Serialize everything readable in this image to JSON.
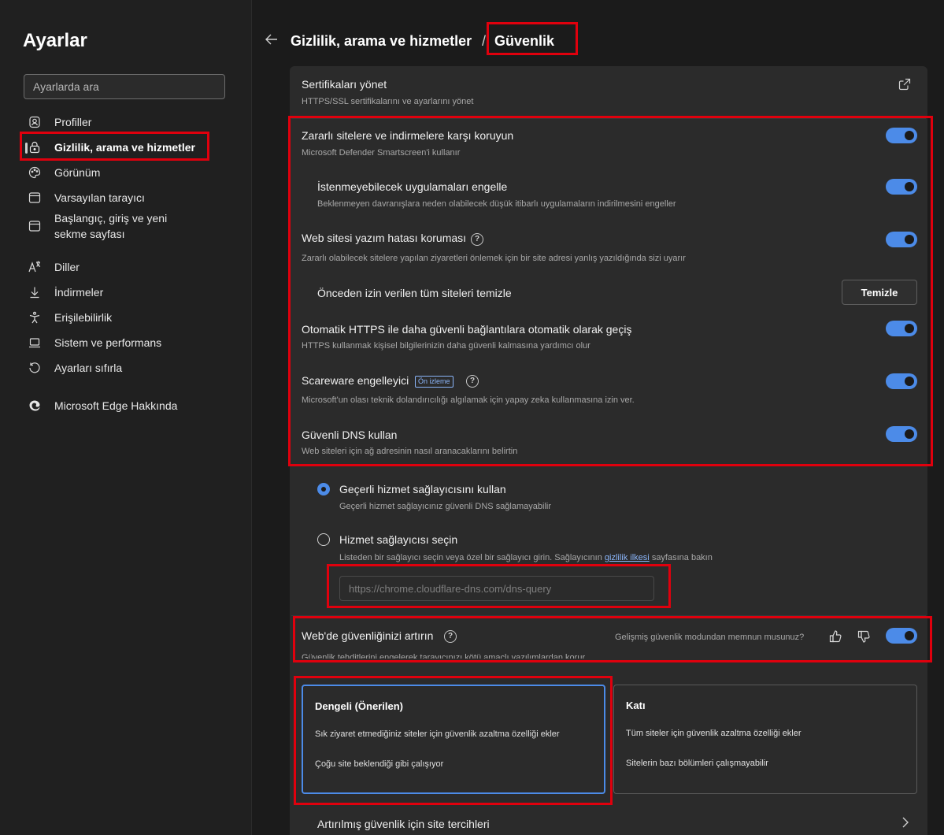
{
  "sidebar": {
    "title": "Ayarlar",
    "search_placeholder": "Ayarlarda ara",
    "items": [
      {
        "label": "Profiller",
        "icon": "profile-icon"
      },
      {
        "label": "Gizlilik, arama ve hizmetler",
        "icon": "lock-icon"
      },
      {
        "label": "Görünüm",
        "icon": "palette-icon"
      },
      {
        "label": "Varsayılan tarayıcı",
        "icon": "browser-icon"
      },
      {
        "label": "Başlangıç, giriş ve yeni sekme sayfası",
        "icon": "home-icon"
      },
      {
        "label": "Diller",
        "icon": "languages-icon"
      },
      {
        "label": "İndirmeler",
        "icon": "download-icon"
      },
      {
        "label": "Erişilebilirlik",
        "icon": "accessibility-icon"
      },
      {
        "label": "Sistem ve performans",
        "icon": "laptop-icon"
      },
      {
        "label": "Ayarları sıfırla",
        "icon": "reset-icon"
      },
      {
        "label": "Microsoft Edge Hakkında",
        "icon": "edge-logo-icon"
      }
    ]
  },
  "header": {
    "crumb_parent": "Gizlilik, arama ve hizmetler",
    "separator": "/",
    "crumb_current": "Güvenlik"
  },
  "security": {
    "certs": {
      "title": "Sertifikaları yönet",
      "desc": "HTTPS/SSL sertifikalarını ve ayarlarını yönet"
    },
    "smartscreen": {
      "title": "Zararlı sitelere ve indirmelere karşı koruyun",
      "desc": "Microsoft Defender Smartscreen'i kullanır",
      "on": true
    },
    "pua": {
      "title": "İstenmeyebilecek uygulamaları engelle",
      "desc": "Beklenmeyen davranışlara neden olabilecek düşük itibarlı uygulamaların indirilmesini engeller",
      "on": true
    },
    "typo": {
      "title": "Web sitesi yazım hatası koruması",
      "desc": "Zararlı olabilecek sitelere yapılan ziyaretleri önlemek için bir site adresi yanlış yazıldığında sizi uyarır",
      "on": true
    },
    "clear_sites": {
      "title": "Önceden izin verilen tüm siteleri temizle",
      "button": "Temizle"
    },
    "auto_https": {
      "title": "Otomatik HTTPS ile daha güvenli bağlantılara otomatik olarak geçiş",
      "desc": "HTTPS kullanmak kişisel bilgilerinizin daha güvenli kalmasına yardımcı olur",
      "on": true
    },
    "scareware": {
      "title": "Scareware engelleyici",
      "badge": "Ön izleme",
      "desc": "Microsoft'un olası teknik dolandırıcılığı algılamak için yapay zeka kullanmasına izin ver.",
      "on": true
    },
    "dns": {
      "title": "Güvenli DNS kullan",
      "desc": "Web siteleri için ağ adresinin nasıl aranacaklarını belirtin",
      "on": true
    },
    "dns_current": {
      "title": "Geçerli hizmet sağlayıcısını kullan",
      "desc": "Geçerli hizmet sağlayıcınız güvenli DNS sağlamayabilir",
      "checked": true
    },
    "dns_choose": {
      "title": "Hizmet sağlayıcısı seçin",
      "desc_before": "Listeden bir sağlayıcı seçin veya özel bir sağlayıcı girin. Sağlayıcının",
      "desc_link": "gizlilik ilkesi",
      "desc_after": "sayfasına bakın",
      "input_placeholder": "https://chrome.cloudflare-dns.com/dns-query",
      "checked": false
    },
    "enhance": {
      "title": "Web'de güvenliğinizi artırın",
      "desc": "Güvenlik tehditlerini engelerek tarayıcınızı kötü amaçlı yazılımlardan korur",
      "feedback": "Gelişmiş güvenlik modundan memnun musunuz?",
      "on": true
    },
    "modes": [
      {
        "title": "Dengeli (Önerilen)",
        "line1": "Sık ziyaret etmediğiniz siteler için güvenlik azaltma özelliği ekler",
        "line2": "Çoğu site beklendiği gibi çalışıyor",
        "selected": true
      },
      {
        "title": "Katı",
        "line1": "Tüm siteler için güvenlik azaltma özelliği ekler",
        "line2": "Sitelerin bazı bölümleri çalışmayabilir",
        "selected": false
      }
    ],
    "site_prefs": {
      "title": "Artırılmış güvenlik için site tercihleri"
    }
  },
  "colors": {
    "accent": "#4c8be8",
    "highlight": "#e0000d",
    "background": "#1b1b1b",
    "card": "#2b2b2b"
  }
}
